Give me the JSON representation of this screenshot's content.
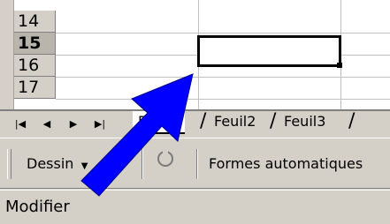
{
  "rows": [
    {
      "number": "14"
    },
    {
      "number": "15"
    },
    {
      "number": "16"
    },
    {
      "number": "17"
    }
  ],
  "sheet_tabs": [
    {
      "label": "Feuil1",
      "active": true
    },
    {
      "label": "Feuil2",
      "active": false
    },
    {
      "label": "Feuil3",
      "active": false
    }
  ],
  "tab_nav": {
    "first": "first-sheet-icon",
    "prev": "prev-sheet-icon",
    "next": "next-sheet-icon",
    "last": "last-sheet-icon"
  },
  "toolbar": {
    "draw_label": "Dessin",
    "rotate_icon": "rotate-icon",
    "autoshapes_label": "Formes automatiques"
  },
  "status": {
    "text": "Modifier"
  },
  "annotation": {
    "arrow_icon": "blue-arrow-icon",
    "arrow_color": "#0000ff"
  }
}
